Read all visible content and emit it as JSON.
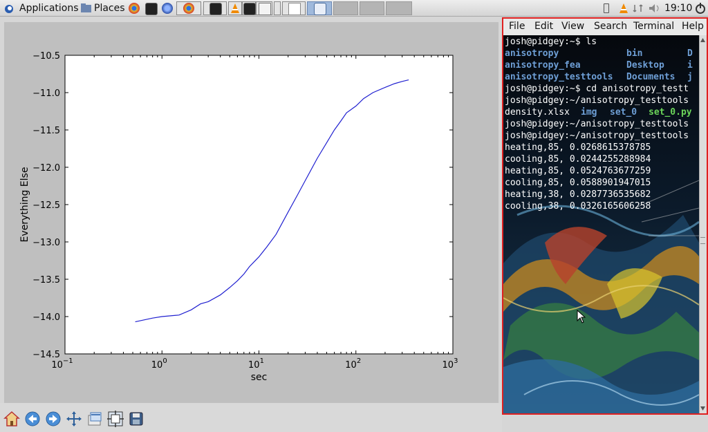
{
  "panel": {
    "applications": "Applications",
    "places": "Places",
    "clock": "19:10"
  },
  "terminal": {
    "menu": [
      "File",
      "Edit",
      "View",
      "Search",
      "Terminal",
      "Help"
    ],
    "lines": [
      {
        "cols": [
          {
            "t": "josh@pidgey:~$ ls"
          }
        ]
      },
      {
        "cols": [
          {
            "t": "anisotropy",
            "k": "dir"
          },
          {
            "t": "bin",
            "k": "dir"
          },
          {
            "t": "D",
            "k": "dir"
          }
        ]
      },
      {
        "cols": [
          {
            "t": "anisotropy_fea",
            "k": "dir"
          },
          {
            "t": "Desktop",
            "k": "dir"
          },
          {
            "t": "i",
            "k": "dir"
          }
        ]
      },
      {
        "cols": [
          {
            "t": "anisotropy_testtools",
            "k": "dir"
          },
          {
            "t": "Documents",
            "k": "dir"
          },
          {
            "t": "j",
            "k": "dir"
          }
        ]
      },
      {
        "cols": [
          {
            "t": "josh@pidgey:~$ cd anisotropy_testt"
          }
        ]
      },
      {
        "cols": [
          {
            "t": "josh@pidgey:~/anisotropy_testtools"
          }
        ]
      },
      {
        "cols": [
          {
            "t": "density.xlsx"
          },
          {
            "t": "img",
            "k": "dir"
          },
          {
            "t": "set_0",
            "k": "dir"
          },
          {
            "t": "set_0.py",
            "k": "exe"
          }
        ]
      },
      {
        "cols": [
          {
            "t": "josh@pidgey:~/anisotropy_testtools"
          }
        ]
      },
      {
        "cols": [
          {
            "t": "josh@pidgey:~/anisotropy_testtools"
          }
        ]
      },
      {
        "cols": [
          {
            "t": "heating,85, 0.0268615378785"
          }
        ]
      },
      {
        "cols": [
          {
            "t": "cooling,85, 0.0244255288984"
          }
        ]
      },
      {
        "cols": [
          {
            "t": "heating,85, 0.0524763677259"
          }
        ]
      },
      {
        "cols": [
          {
            "t": "cooling,85, 0.0588901947015"
          }
        ]
      },
      {
        "cols": [
          {
            "t": "heating,38, 0.0287736535682"
          }
        ]
      },
      {
        "cols": [
          {
            "t": "cooling,38, 0.0326165606258"
          }
        ]
      }
    ]
  },
  "colors": {
    "plot_line": "#1f1fd0",
    "terminal_dir": "#6e9fd6",
    "terminal_exe": "#6cd65a",
    "terminal_border": "#e02020"
  },
  "chart_data": {
    "type": "line",
    "title": "",
    "xlabel": "sec",
    "ylabel": "Everything Else",
    "xscale": "log",
    "xlim": [
      0.1,
      1000
    ],
    "ylim": [
      -14.5,
      -10.5
    ],
    "x_ticks": [
      {
        "value": 0.1,
        "base": "10",
        "exp": "−1"
      },
      {
        "value": 1,
        "base": "10",
        "exp": "0"
      },
      {
        "value": 10,
        "base": "10",
        "exp": "1"
      },
      {
        "value": 100,
        "base": "10",
        "exp": "2"
      },
      {
        "value": 1000,
        "base": "10",
        "exp": "3"
      }
    ],
    "y_ticks": [
      {
        "value": -10.5,
        "label": "−10.5"
      },
      {
        "value": -11.0,
        "label": "−11.0"
      },
      {
        "value": -11.5,
        "label": "−11.5"
      },
      {
        "value": -12.0,
        "label": "−12.0"
      },
      {
        "value": -12.5,
        "label": "−12.5"
      },
      {
        "value": -13.0,
        "label": "−13.0"
      },
      {
        "value": -13.5,
        "label": "−13.5"
      },
      {
        "value": -14.0,
        "label": "−14.0"
      },
      {
        "value": -14.5,
        "label": "−14.5"
      }
    ],
    "grid": false,
    "series": [
      {
        "x": [
          0.53,
          0.8,
          1.0,
          1.5,
          2.0,
          2.5,
          3.0,
          4.0,
          5.0,
          6.0,
          7.0,
          8.0,
          10.0,
          12.0,
          15.0,
          20.0,
          25.0,
          30.0,
          40.0,
          50.0,
          60.0,
          70.0,
          80.0,
          100.0,
          120.0,
          150.0,
          200.0,
          250.0,
          300.0,
          350.0
        ],
        "y": [
          -14.07,
          -14.02,
          -14.0,
          -13.98,
          -13.91,
          -13.83,
          -13.8,
          -13.71,
          -13.61,
          -13.52,
          -13.43,
          -13.33,
          -13.2,
          -13.07,
          -12.9,
          -12.6,
          -12.37,
          -12.18,
          -11.88,
          -11.67,
          -11.5,
          -11.38,
          -11.27,
          -11.18,
          -11.08,
          -11.0,
          -10.93,
          -10.88,
          -10.85,
          -10.83
        ]
      }
    ]
  }
}
